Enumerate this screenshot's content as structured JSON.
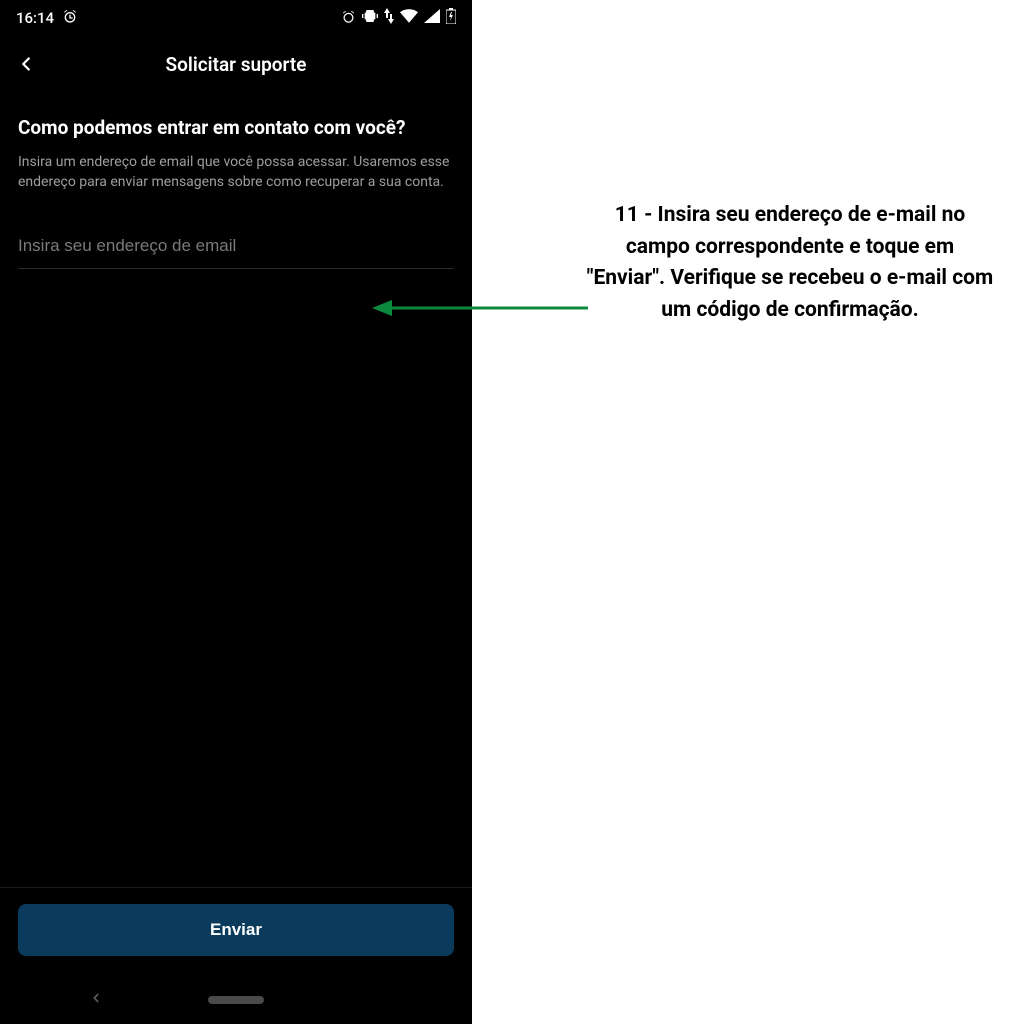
{
  "status": {
    "time": "16:14"
  },
  "appbar": {
    "title": "Solicitar suporte"
  },
  "content": {
    "heading": "Como podemos entrar em contato com você?",
    "description": "Insira um endereço de email que você possa acessar. Usaremos esse endereço para enviar mensagens sobre como recuperar a sua conta.",
    "email_placeholder": "Insira seu endereço de email"
  },
  "footer": {
    "send_label": "Enviar"
  },
  "instruction": {
    "text": "11 - Insira seu endereço de e-mail no campo correspondente e toque em \"Enviar\". Verifique se recebeu o e-mail com um código de confirmação."
  },
  "colors": {
    "arrow": "#0b8a3e",
    "button_bg": "#0a3a5c"
  }
}
